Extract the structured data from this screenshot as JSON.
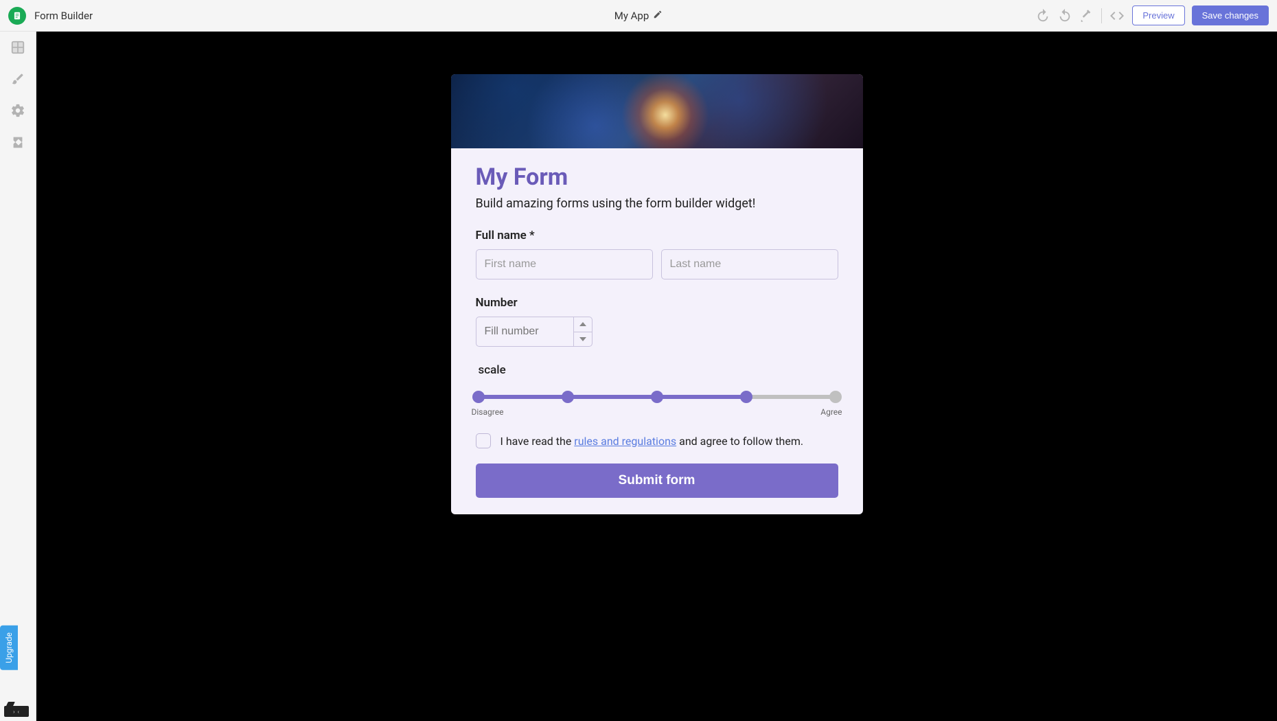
{
  "topbar": {
    "app_label": "Form Builder",
    "app_title": "My App",
    "preview_label": "Preview",
    "save_label": "Save changes"
  },
  "upgrade_label": "Upgrade",
  "form": {
    "title": "My Form",
    "subtitle": "Build amazing forms using the form builder widget!",
    "full_name": {
      "label": "Full name *",
      "first_placeholder": "First name",
      "last_placeholder": "Last name"
    },
    "number": {
      "label": "Number",
      "placeholder": "Fill number"
    },
    "scale": {
      "label": "scale",
      "left": "Disagree",
      "right": "Agree",
      "steps": 5,
      "value": 4
    },
    "consent": {
      "prefix": "I have read the ",
      "link": "rules and regulations",
      "suffix": " and agree to follow them."
    },
    "submit_label": "Submit form"
  },
  "colors": {
    "accent": "#7a6cc9",
    "logo": "#1aaa55",
    "primary_btn": "#6873d9"
  }
}
